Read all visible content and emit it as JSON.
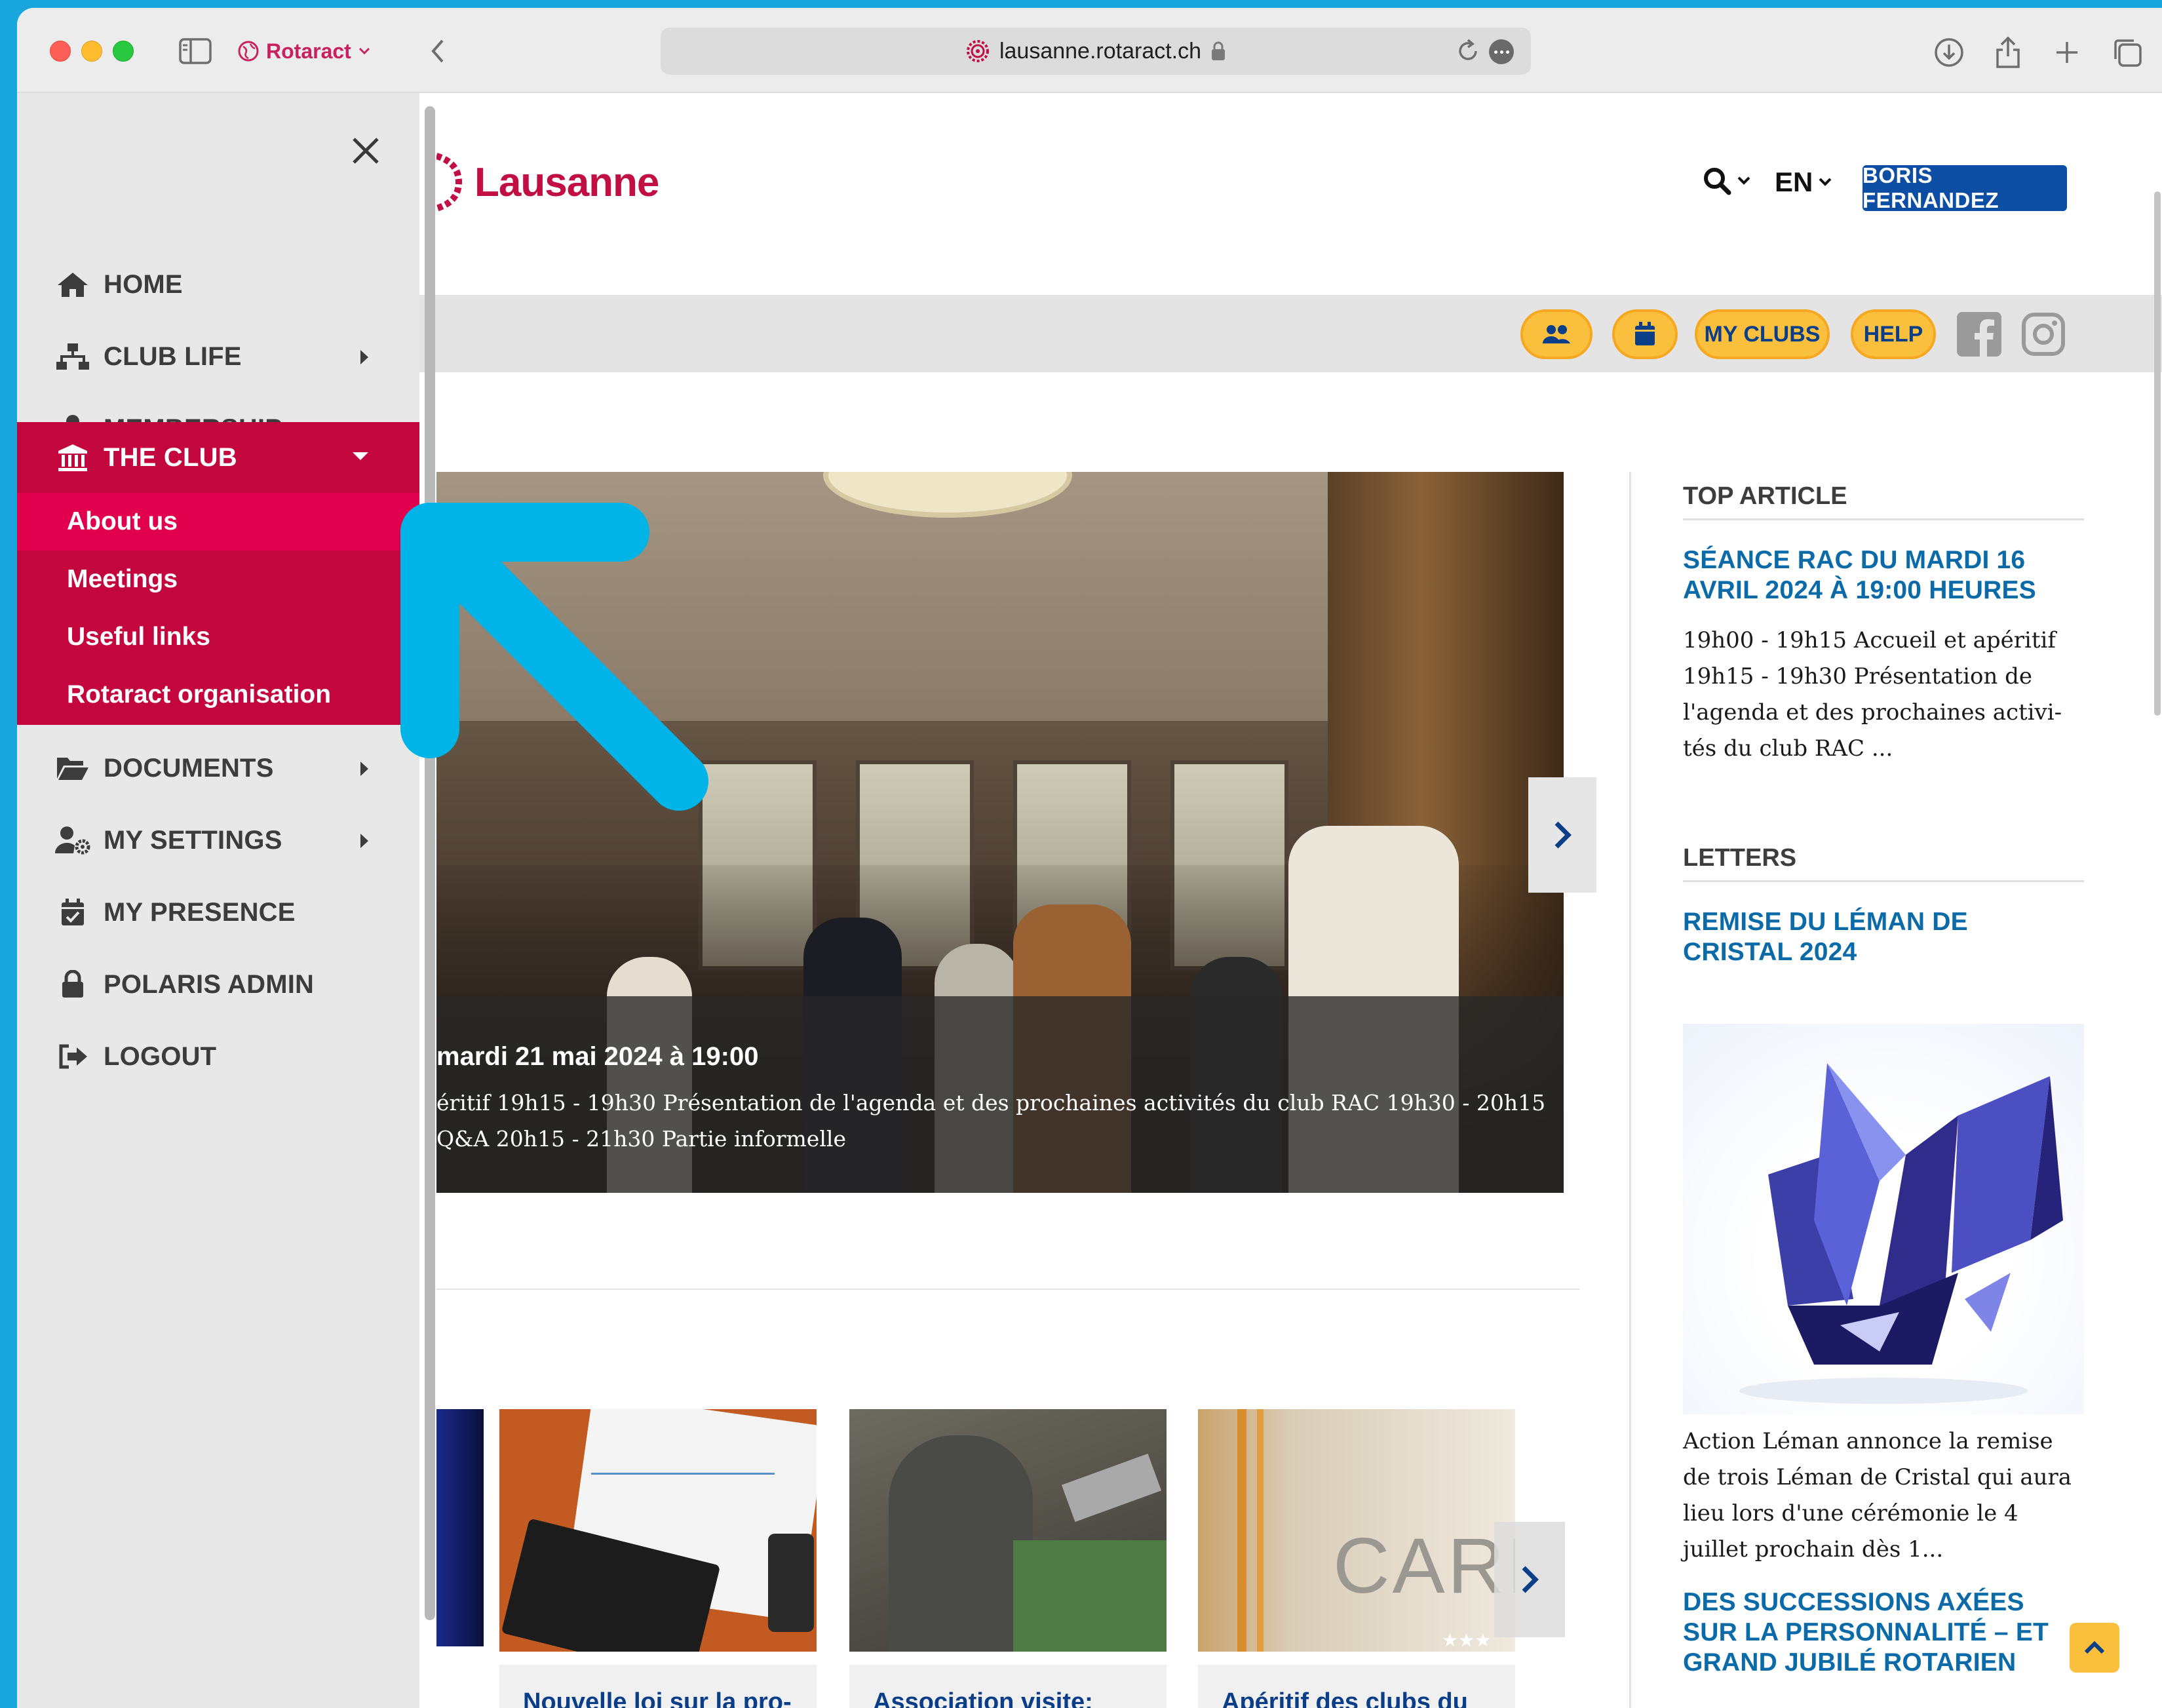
{
  "browser": {
    "profile_label": "Rotaract",
    "url": "lausanne.rotaract.ch"
  },
  "site": {
    "logo_text": "Lausanne",
    "language": "EN",
    "user_button": "BORIS FERNANDEZ",
    "my_clubs": "MY CLUBS",
    "help": "HELP"
  },
  "hero": {
    "title": "mardi 21 mai 2024 à 19:00",
    "text_line1": "éritif 19h15 - 19h30 Présentation de l'agenda et des prochaines activités du club RAC 19h30 - 20h15",
    "text_line2": "Q&A 20h15 - 21h30 Partie informelle"
  },
  "cards": [
    {
      "title": "Nouvelle loi sur la pro-tection des données"
    },
    {
      "title": "Association visite: trois fois plus de stages pro-"
    },
    {
      "title": "Apéritif des clubs du RMC Le Grand Lau-"
    }
  ],
  "card_caption_text": "CARL",
  "right_column": {
    "top_article": {
      "heading": "TOP ARTICLE",
      "title": "SÉANCE RAC DU MARDI 16 AVRIL 2024 À 19:00 HEURES",
      "text": "19h00 - 19h15 Accueil et apéritif 19h15 - 19h30 Présentation de l'agenda et des prochaines activi-tés du club RAC ..."
    },
    "letters": {
      "heading": "LETTERS",
      "title": "REMISE DU LÉMAN DE CRISTAL 2024",
      "text": "Action Léman annonce la remise de trois Léman de Cristal qui aura lieu lors d'une cérémonie le 4 juillet prochain dès 1...",
      "title2": "DES SUCCESSIONS AXÉES SUR LA PERSONNALITÉ – ET GRAND JUBILÉ ROTARIEN"
    }
  },
  "side_menu": {
    "items": [
      {
        "label": "HOME",
        "icon": "home-icon"
      },
      {
        "label": "CLUB LIFE",
        "icon": "sitemap-icon"
      },
      {
        "label": "MEMBERSHIP",
        "icon": "user-tie-icon"
      },
      {
        "label": "THE CLUB",
        "icon": "landmark-icon"
      },
      {
        "label": "DOCUMENTS",
        "icon": "folder-open-icon"
      },
      {
        "label": "MY SETTINGS",
        "icon": "user-cog-icon"
      },
      {
        "label": "MY PRESENCE",
        "icon": "calendar-check-icon"
      },
      {
        "label": "POLARIS ADMIN",
        "icon": "lock-icon"
      },
      {
        "label": "LOGOUT",
        "icon": "sign-out-icon"
      }
    ],
    "submenu": [
      {
        "label": "About us"
      },
      {
        "label": "Meetings"
      },
      {
        "label": "Useful links"
      },
      {
        "label": "Rotaract organisation"
      }
    ]
  },
  "colors": {
    "brand_red": "#c4063f",
    "brand_blue": "#0d4ea5",
    "accent_yellow": "#fbbf3e",
    "arrow_blue": "#00b4e8"
  }
}
